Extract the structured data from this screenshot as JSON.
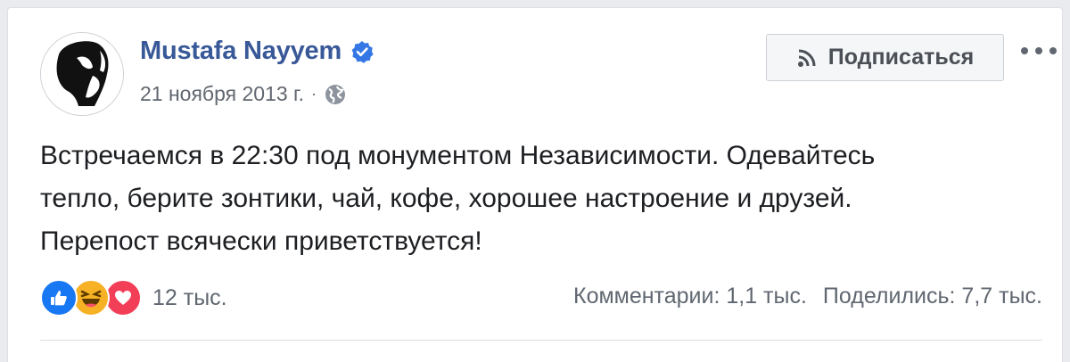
{
  "post": {
    "author_name": "Mustafa Nayyem",
    "date": "21 ноября 2013 г.",
    "separator": "·",
    "privacy_icon": "globe-icon",
    "verified_icon": "verified-badge-icon",
    "text": "Встречаемся в 22:30 под монументом Независимости. Одевайтесь\nтепло, берите зонтики, чай, кофе, хорошее настроение и друзей.\nПерепост всячески приветствуется!"
  },
  "actions": {
    "follow_label": "Подписаться",
    "follow_icon": "rss-icon",
    "more_icon": "more-dots-icon"
  },
  "engagement": {
    "reactions": [
      "like",
      "haha",
      "love"
    ],
    "reaction_count": "12 тыс.",
    "comments": "Комментарии: 1,1 тыс.",
    "shares": "Поделились: 7,7 тыс."
  },
  "colors": {
    "author": "#385898",
    "verified": "#3578e5",
    "like": "#1877f2",
    "haha": "#f7b125",
    "love": "#f33e58"
  }
}
